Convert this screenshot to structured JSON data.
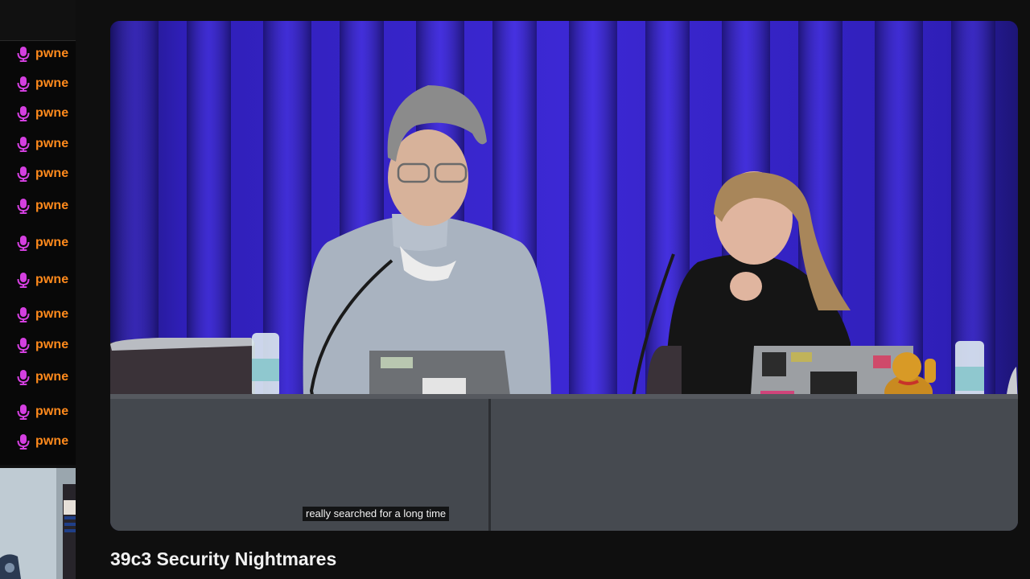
{
  "chat": {
    "messages": [
      {
        "user": "pwne",
        "icon": "microphone-icon"
      },
      {
        "user": "pwne",
        "icon": "microphone-icon"
      },
      {
        "user": "pwne",
        "icon": "microphone-icon"
      },
      {
        "user": "pwne",
        "icon": "microphone-icon"
      },
      {
        "user": "pwne",
        "icon": "microphone-icon"
      },
      {
        "user": "pwne",
        "icon": "microphone-icon"
      },
      {
        "user": "pwne",
        "icon": "microphone-icon"
      },
      {
        "user": "pwne",
        "icon": "microphone-icon"
      },
      {
        "user": "pwne",
        "icon": "microphone-icon"
      },
      {
        "user": "pwne",
        "icon": "microphone-icon"
      },
      {
        "user": "pwne",
        "icon": "microphone-icon"
      },
      {
        "user": "pwne",
        "icon": "microphone-icon"
      },
      {
        "user": "pwne",
        "icon": "microphone-icon"
      }
    ],
    "username_color": "#ff8a1c",
    "icon_color": "#d43fe0"
  },
  "video": {
    "caption": "really searched for a long time",
    "title": "39c3 Security Nightmares",
    "curtain_color": "#3b22c9"
  }
}
